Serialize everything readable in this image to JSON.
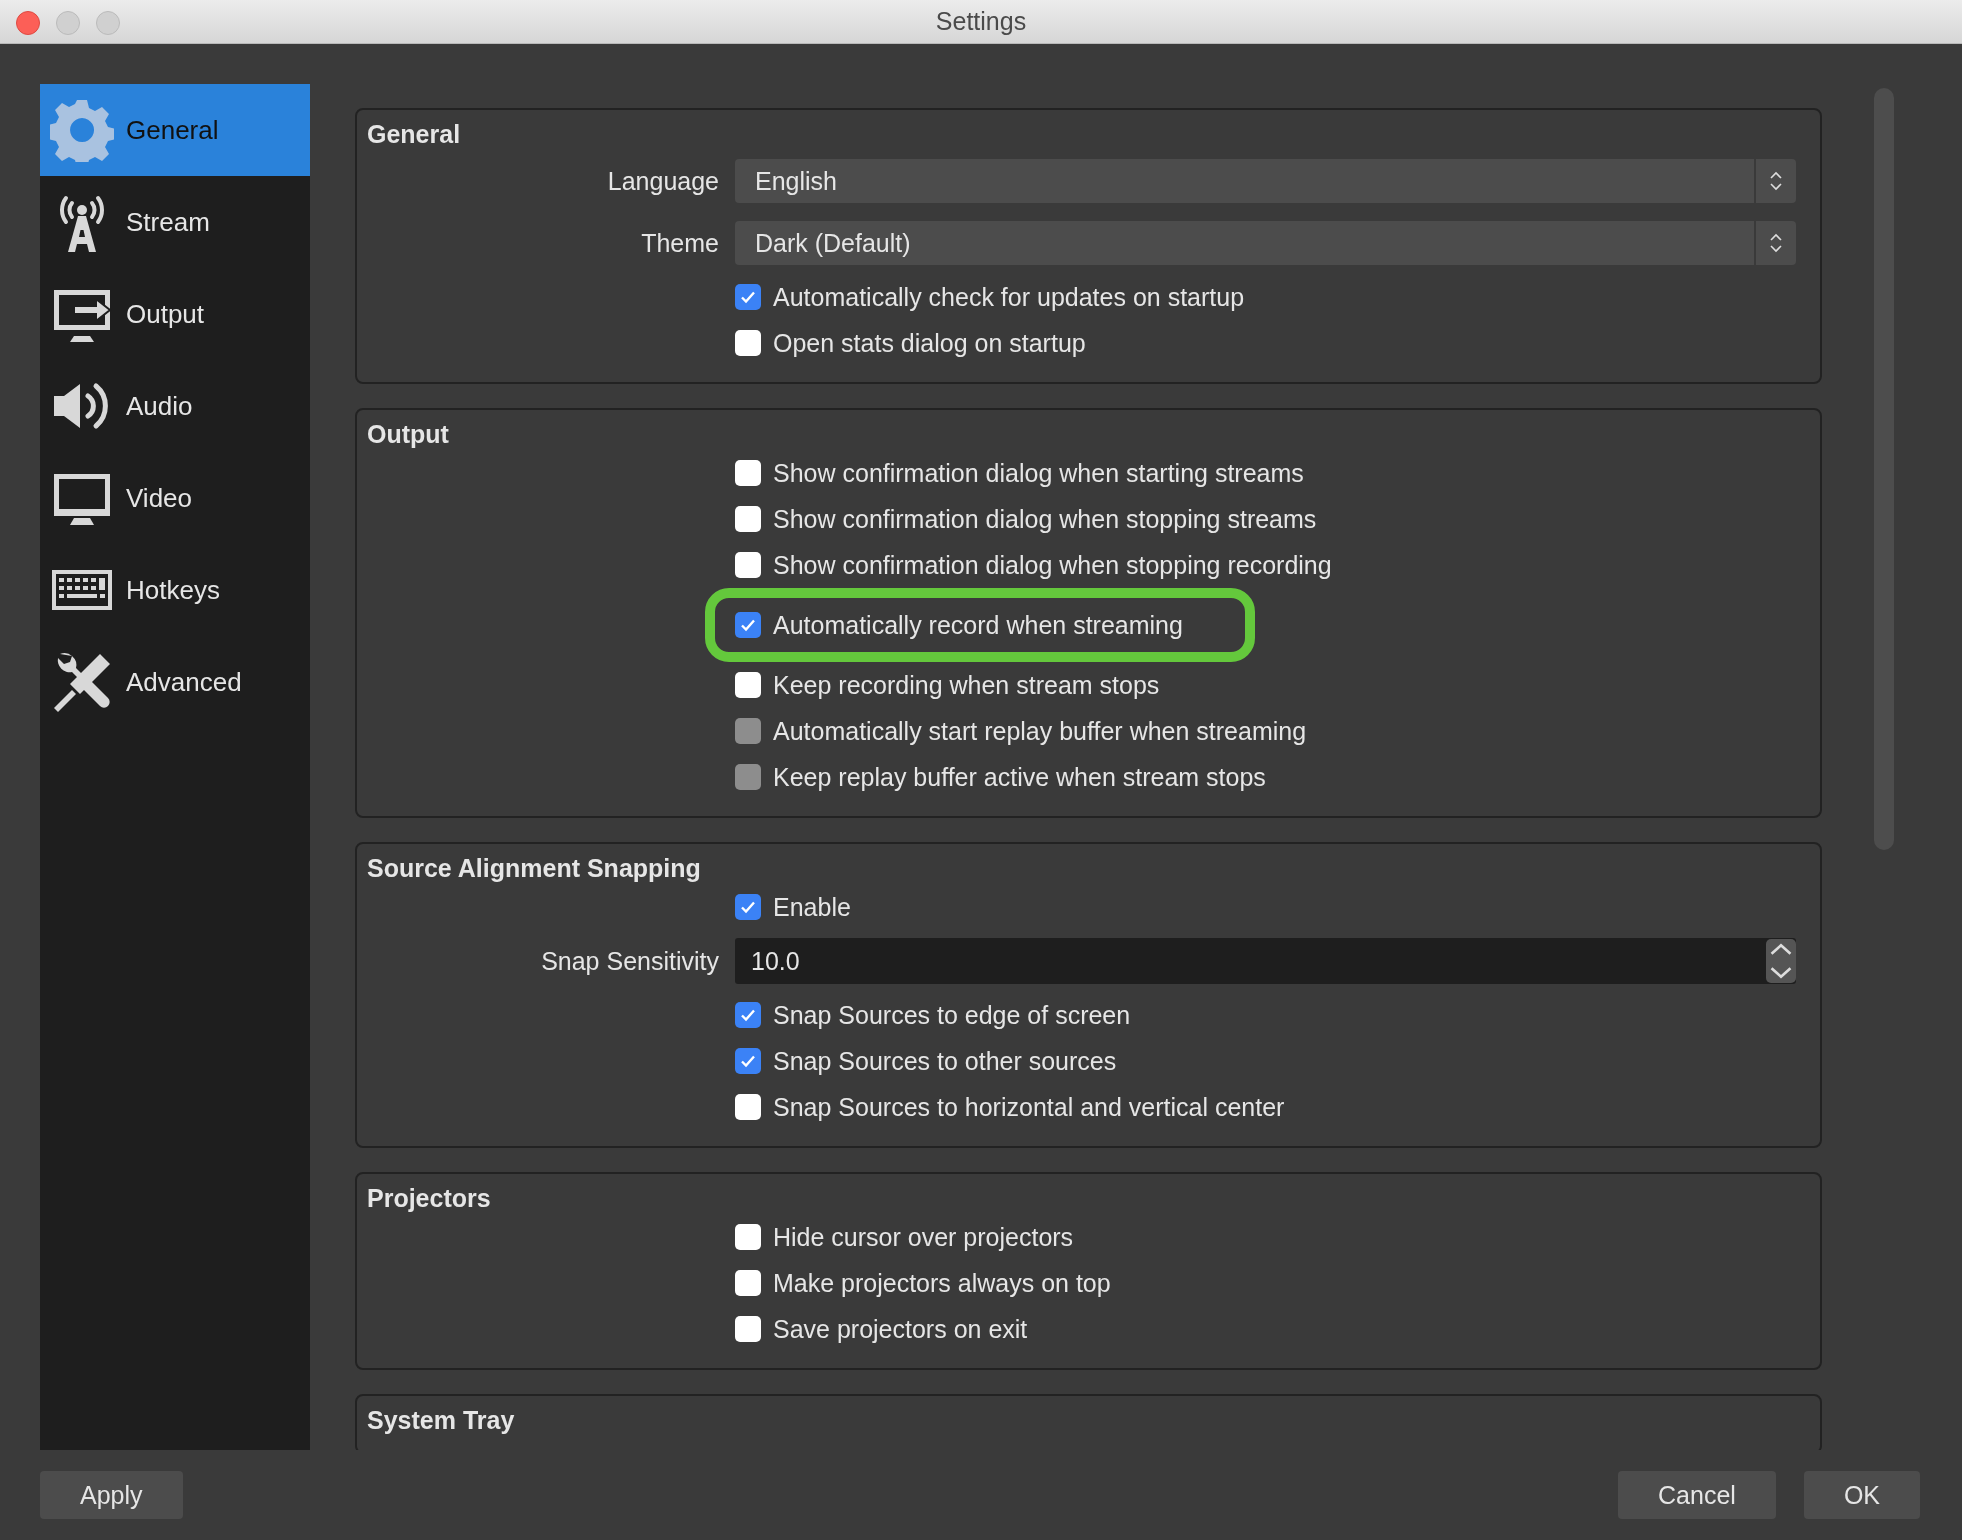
{
  "window": {
    "title": "Settings"
  },
  "sidebar": {
    "items": [
      {
        "label": "General",
        "selected": true
      },
      {
        "label": "Stream",
        "selected": false
      },
      {
        "label": "Output",
        "selected": false
      },
      {
        "label": "Audio",
        "selected": false
      },
      {
        "label": "Video",
        "selected": false
      },
      {
        "label": "Hotkeys",
        "selected": false
      },
      {
        "label": "Advanced",
        "selected": false
      }
    ]
  },
  "groups": [
    {
      "title": "General",
      "rows": [
        {
          "kind": "combo",
          "label": "Language",
          "value": "English"
        },
        {
          "kind": "combo",
          "label": "Theme",
          "value": "Dark (Default)"
        },
        {
          "kind": "checkbox",
          "label": "Automatically check for updates on startup",
          "checked": true,
          "disabled": false
        },
        {
          "kind": "checkbox",
          "label": "Open stats dialog on startup",
          "checked": false,
          "disabled": false
        }
      ]
    },
    {
      "title": "Output",
      "rows": [
        {
          "kind": "checkbox",
          "label": "Show confirmation dialog when starting streams",
          "checked": false,
          "disabled": false
        },
        {
          "kind": "checkbox",
          "label": "Show confirmation dialog when stopping streams",
          "checked": false,
          "disabled": false
        },
        {
          "kind": "checkbox",
          "label": "Show confirmation dialog when stopping recording",
          "checked": false,
          "disabled": false
        },
        {
          "kind": "checkbox",
          "label": "Automatically record when streaming",
          "checked": true,
          "disabled": false,
          "highlighted": true
        },
        {
          "kind": "checkbox",
          "label": "Keep recording when stream stops",
          "checked": false,
          "disabled": false
        },
        {
          "kind": "checkbox",
          "label": "Automatically start replay buffer when streaming",
          "checked": false,
          "disabled": true
        },
        {
          "kind": "checkbox",
          "label": "Keep replay buffer active when stream stops",
          "checked": false,
          "disabled": true
        }
      ]
    },
    {
      "title": "Source Alignment Snapping",
      "rows": [
        {
          "kind": "checkbox",
          "label": "Enable",
          "checked": true,
          "disabled": false
        },
        {
          "kind": "spin",
          "label": "Snap Sensitivity",
          "value": "10.0"
        },
        {
          "kind": "checkbox",
          "label": "Snap Sources to edge of screen",
          "checked": true,
          "disabled": false
        },
        {
          "kind": "checkbox",
          "label": "Snap Sources to other sources",
          "checked": true,
          "disabled": false
        },
        {
          "kind": "checkbox",
          "label": "Snap Sources to horizontal and vertical center",
          "checked": false,
          "disabled": false
        }
      ]
    },
    {
      "title": "Projectors",
      "rows": [
        {
          "kind": "checkbox",
          "label": "Hide cursor over projectors",
          "checked": false,
          "disabled": false
        },
        {
          "kind": "checkbox",
          "label": "Make projectors always on top",
          "checked": false,
          "disabled": false
        },
        {
          "kind": "checkbox",
          "label": "Save projectors on exit",
          "checked": false,
          "disabled": false
        }
      ]
    },
    {
      "title": "System Tray"
    }
  ],
  "buttons": {
    "left": [
      "Apply"
    ],
    "right": [
      "Cancel",
      "OK"
    ]
  }
}
